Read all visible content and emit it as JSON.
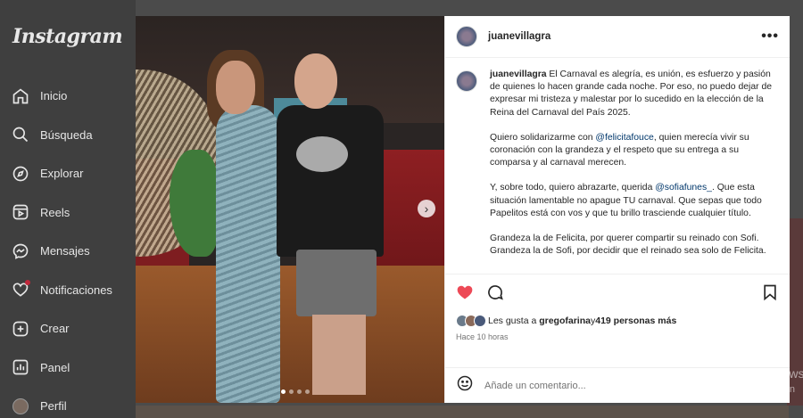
{
  "app": {
    "logo": "Instagram"
  },
  "sidebar": {
    "items": [
      {
        "label": "Inicio",
        "icon": "home-icon"
      },
      {
        "label": "Búsqueda",
        "icon": "search-icon"
      },
      {
        "label": "Explorar",
        "icon": "compass-icon"
      },
      {
        "label": "Reels",
        "icon": "reels-icon"
      },
      {
        "label": "Mensajes",
        "icon": "messenger-icon"
      },
      {
        "label": "Notificaciones",
        "icon": "heart-icon"
      },
      {
        "label": "Crear",
        "icon": "plus-square-icon"
      },
      {
        "label": "Panel",
        "icon": "chart-icon"
      },
      {
        "label": "Perfil",
        "icon": "avatar"
      }
    ]
  },
  "post": {
    "username": "juanevillagra",
    "caption": {
      "author": "juanevillagra",
      "p1": " El Carnaval es alegría, es unión, es esfuerzo y pasión de quienes lo hacen grande cada noche. Por eso, no puedo dejar de expresar mi tristeza y malestar por lo sucedido en la elección de la Reina del Carnaval del País 2025.",
      "p2_a": "Quiero solidarizarme con ",
      "p2_mention": "@felicitafouce",
      "p2_b": ", quien merecía vivir su coronación con la grandeza y el respeto que su entrega a su comparsa y al carnaval merecen.",
      "p3_a": "Y, sobre todo, quiero abrazarte, querida ",
      "p3_mention": "@sofiafunes_",
      "p3_b": ". Que esta situación lamentable no apague TU carnaval. Que sepas que todo Papelitos está con vos y que tu brillo trasciende cualquier título.",
      "p4": "Grandeza la de Felicita, por querer compartir su reinado con Sofi. Grandeza la de Sofi, por decidir que el reinado sea solo de Felicita."
    },
    "likes_prefix": "Les gusta a ",
    "likes_user": "gregofarina",
    "likes_mid": " y ",
    "likes_count": "419 personas más",
    "time": "Hace 10 horas",
    "comment_placeholder": "Añade un comentario...",
    "carousel": {
      "current": 1,
      "total": 4
    },
    "colors": {
      "like": "#ed4956",
      "mention": "#00376b"
    }
  },
  "watermark": {
    "line1": "Activar Windows",
    "line2": "Ve a Configuración"
  }
}
